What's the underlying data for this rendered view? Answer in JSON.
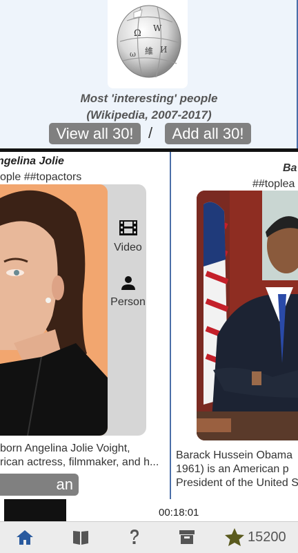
{
  "header": {
    "subtitle_line1": "Most 'interesting' people",
    "subtitle_line2": "(Wikipedia, 2007-2017)",
    "view_all_label": "View all 30!",
    "separator": "/",
    "add_all_label": "Add all 30!"
  },
  "cards": [
    {
      "name": "ngelina Jolie",
      "tags": "ople ##topactors",
      "side_actions": [
        {
          "icon": "film-icon",
          "label": "Video"
        },
        {
          "icon": "person-icon",
          "label": "Person"
        }
      ],
      "desc_line1": "born Angelina Jolie Voight,",
      "desc_line2": "rican actress, filmmaker, and h...",
      "interest_button": "an interest!"
    },
    {
      "name": "Ba",
      "tags": "##toplea",
      "desc_line1": "Barack Hussein Obama",
      "desc_line2": "1961) is an American p",
      "desc_line3": "President of the United S"
    }
  ],
  "behind_video": {
    "time": "00:18:01"
  },
  "nav": {
    "items": [
      "home-icon",
      "book-icon",
      "help-icon",
      "archive-icon",
      "star-icon"
    ],
    "score": "15200",
    "colors": {
      "active": "#2a5a9e",
      "inactive": "#555555",
      "star": "#5a5a1e"
    }
  }
}
